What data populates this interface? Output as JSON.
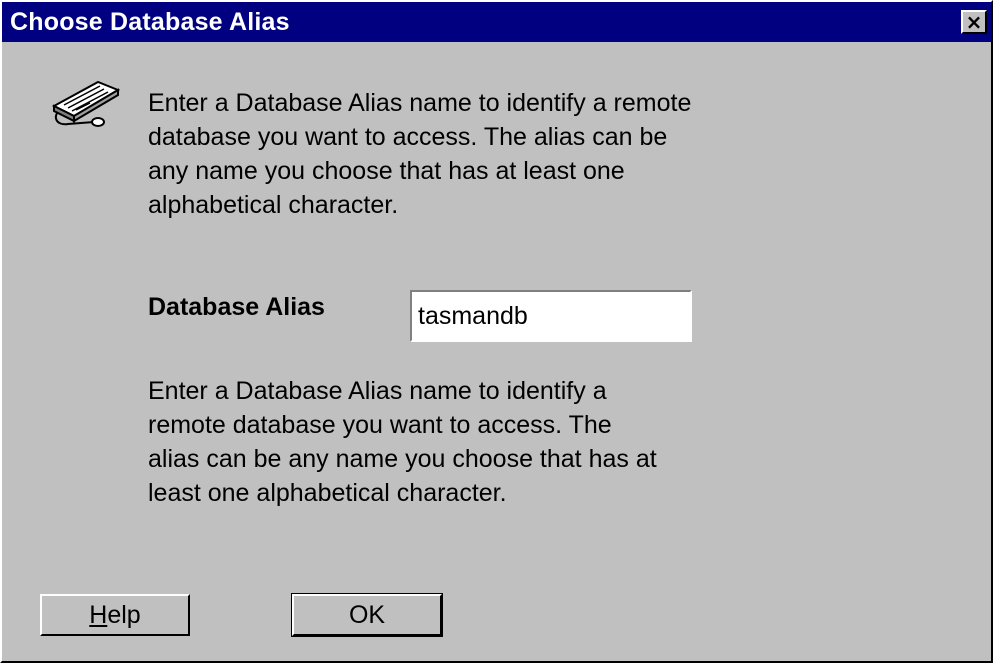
{
  "window": {
    "title": "Choose Database Alias",
    "close_glyph": "×"
  },
  "icon": {
    "name": "keyboard-terminal-icon"
  },
  "intro": {
    "lines": [
      "Enter a Database Alias name to identify a remote",
      "database you want to access.  The alias can be",
      "any name you choose that has at least one",
      "alphabetical character."
    ]
  },
  "alias": {
    "label": "Database Alias",
    "value": "tasmandb"
  },
  "help_text": {
    "lines": [
      "Enter a Database Alias name to identify a",
      "remote database you want to access.  The",
      "alias can be any name you choose that has at",
      "least one alphabetical character."
    ]
  },
  "buttons": {
    "help_mnemonic": "H",
    "help_rest": "elp",
    "ok_label": "OK"
  },
  "colors": {
    "titlebar": "#000080",
    "face": "#c0c0c0"
  }
}
